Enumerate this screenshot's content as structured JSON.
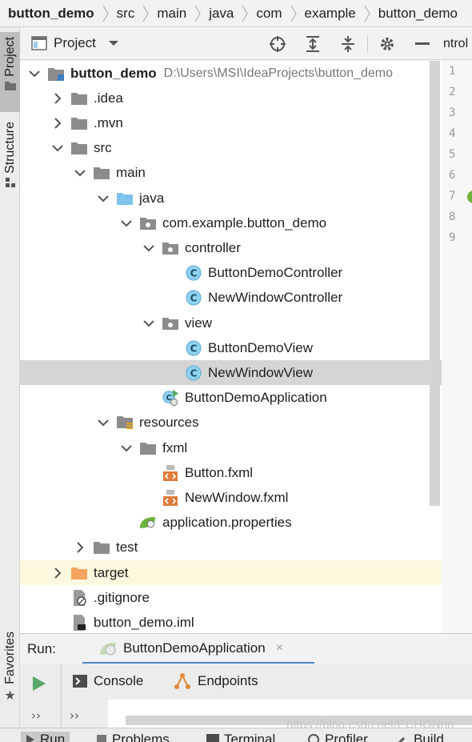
{
  "breadcrumb": [
    "button_demo",
    "src",
    "main",
    "java",
    "com",
    "example",
    "button_demo"
  ],
  "left_strip": {
    "project": "Project",
    "structure": "Structure",
    "favorites": "Favorites"
  },
  "project_panel": {
    "title": "Project"
  },
  "tree": [
    {
      "label": "button_demo",
      "path": "D:\\Users\\MSI\\IdeaProjects\\button_demo",
      "icon": "module-folder-icon",
      "state": "expanded"
    },
    {
      "label": ".idea",
      "icon": "folder-icon",
      "state": "collapsed"
    },
    {
      "label": ".mvn",
      "icon": "folder-icon",
      "state": "collapsed"
    },
    {
      "label": "src",
      "icon": "folder-icon",
      "state": "expanded"
    },
    {
      "label": "main",
      "icon": "folder-icon",
      "state": "expanded"
    },
    {
      "label": "java",
      "icon": "source-folder-icon",
      "state": "expanded"
    },
    {
      "label": "com.example.button_demo",
      "icon": "package-icon",
      "state": "expanded"
    },
    {
      "label": "controller",
      "icon": "package-icon",
      "state": "expanded"
    },
    {
      "label": "ButtonDemoController",
      "icon": "class-icon"
    },
    {
      "label": "NewWindowController",
      "icon": "class-icon"
    },
    {
      "label": "view",
      "icon": "package-icon",
      "state": "expanded"
    },
    {
      "label": "ButtonDemoView",
      "icon": "class-icon"
    },
    {
      "label": "NewWindowView",
      "icon": "class-icon",
      "selected": true
    },
    {
      "label": "ButtonDemoApplication",
      "icon": "spring-boot-app-icon"
    },
    {
      "label": "resources",
      "icon": "resources-folder-icon",
      "state": "expanded"
    },
    {
      "label": "fxml",
      "icon": "folder-icon",
      "state": "expanded"
    },
    {
      "label": "Button.fxml",
      "icon": "fxml-file-icon"
    },
    {
      "label": "NewWindow.fxml",
      "icon": "fxml-file-icon"
    },
    {
      "label": "application.properties",
      "icon": "spring-properties-icon"
    },
    {
      "label": "test",
      "icon": "folder-icon",
      "state": "collapsed"
    },
    {
      "label": "target",
      "icon": "excluded-folder-icon",
      "state": "collapsed"
    },
    {
      "label": ".gitignore",
      "icon": "gitignore-file-icon"
    },
    {
      "label": "button_demo.iml",
      "icon": "iml-file-icon"
    }
  ],
  "editor": {
    "tab_fragment": "ntrol",
    "line_numbers": [
      "1",
      "2",
      "3",
      "4",
      "5",
      "6",
      "7",
      "8",
      "9"
    ]
  },
  "run": {
    "label": "Run:",
    "tab": "ButtonDemoApplication",
    "close": "×",
    "subtabs": [
      "Console",
      "Endpoints"
    ],
    "more": "››"
  },
  "bottom_bar": [
    "Run",
    "Problems",
    "Terminal",
    "Profiler",
    "Build"
  ],
  "watermark": "https://blog.csdn.net/ECHONnn",
  "colors": {
    "selection": "#d5d5d5",
    "highlight_row": "#fbf8de",
    "class_icon": "#8fd1f0",
    "spring_green": "#6db33f",
    "run_green": "#59a869",
    "tab_underline": "#4a88c7"
  }
}
